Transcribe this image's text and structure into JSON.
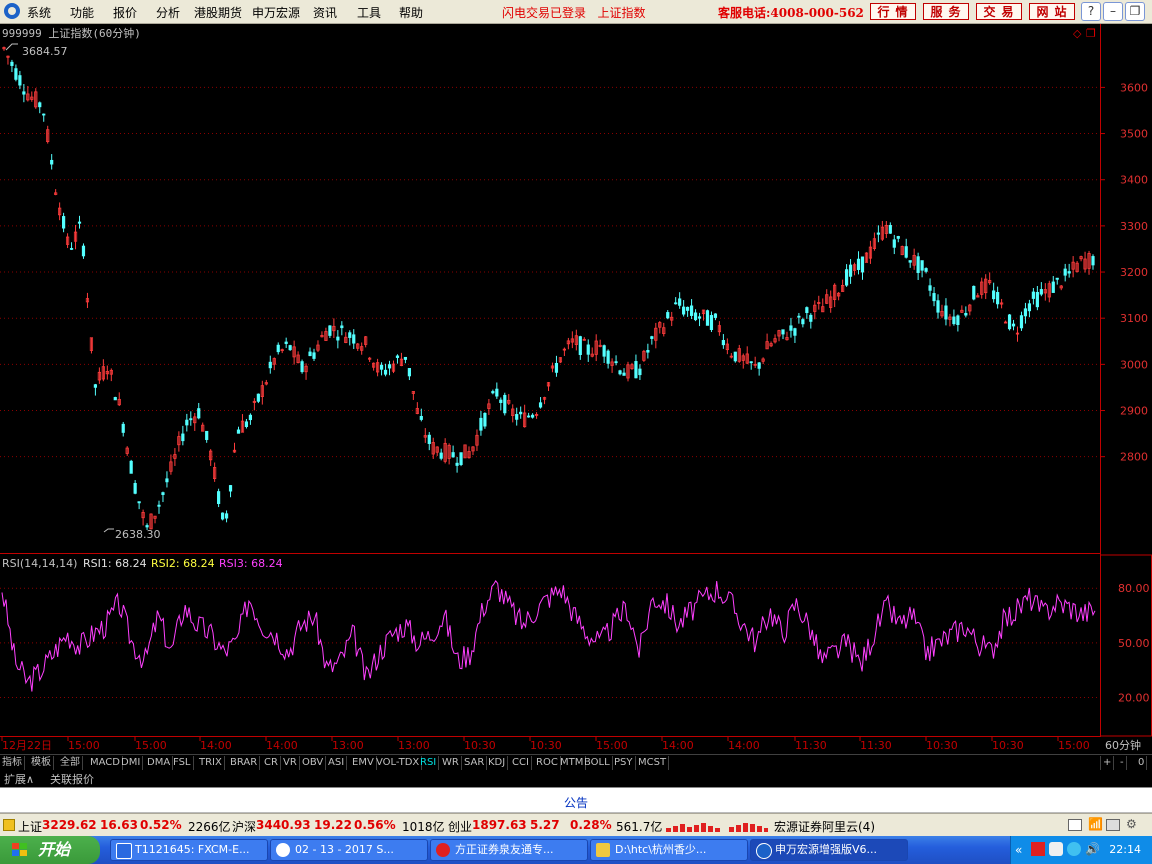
{
  "menu": {
    "items": [
      "系统",
      "功能",
      "报价",
      "分析",
      "港股期货",
      "申万宏源",
      "资讯",
      "工具",
      "帮助"
    ],
    "flash_status": "闪电交易已登录",
    "index_name": "上证指数",
    "hotline": "客服电话:4008-000-562",
    "nav_buttons": [
      "行情",
      "服务",
      "交易",
      "网站"
    ]
  },
  "price_panel": {
    "title": "999999 上证指数(60分钟)",
    "high_label": "3684.57",
    "low_label": "2638.30",
    "y_ticks": [
      "3600",
      "3500",
      "3400",
      "3300",
      "3200",
      "3100",
      "3000",
      "2900",
      "2800"
    ]
  },
  "rsi_panel": {
    "params": "RSI(14,14,14)",
    "rsi1_label": "RSI1: 68.24",
    "rsi2_label": "RSI2: 68.24",
    "rsi3_label": "RSI3: 68.24",
    "y_ticks": [
      "80.00",
      "50.00",
      "20.00"
    ]
  },
  "time_axis": {
    "labels": [
      "12月22日",
      "15:00",
      "15:00",
      "14:00",
      "14:00",
      "13:00",
      "13:00",
      "10:30",
      "10:30",
      "15:00",
      "14:00",
      "14:00",
      "11:30",
      "11:30",
      "10:30",
      "10:30",
      "15:00"
    ],
    "period": "60分钟",
    "controls": [
      "+",
      "-",
      "0"
    ]
  },
  "indicator_tabs": [
    "指标",
    "模板",
    "全部",
    "MACD",
    "DMI",
    "DMA",
    "FSL",
    "TRIX",
    "BRAR",
    "CR",
    "VR",
    "OBV",
    "ASI",
    "EMV",
    "VOL-TDX",
    "RSI",
    "WR",
    "SAR",
    "KDJ",
    "CCI",
    "ROC",
    "MTM",
    "BOLL",
    "PSY",
    "MCST"
  ],
  "sub_tabs": [
    "扩展∧",
    "关联报价"
  ],
  "announcement": "公告",
  "status": {
    "sh_label": "上证",
    "sh_value": "3229.62",
    "sh_change": "16.63",
    "sh_pct": "0.52%",
    "sh_vol": "2266亿",
    "hs_label": "沪深",
    "hs_value": "3440.93",
    "hs_change": "19.22",
    "hs_pct": "0.56%",
    "hs_vol": "1018亿",
    "cy_label": "创业",
    "cy_value": "1897.63",
    "cy_change": "5.27",
    "cy_pct": "0.28%",
    "cy_vol": "561.7亿",
    "server": "宏源证券阿里云(4)"
  },
  "taskbar": {
    "start": "开始",
    "tasks": [
      "T1121645: FXCM-E...",
      "02 - 13 - 2017 S...",
      "方正证券泉友通专...",
      "D:\\htc\\杭州香少...",
      "申万宏源增强版V6..."
    ],
    "clock": "22:14"
  },
  "colors": {
    "up": "#ff3c3c",
    "down": "#54ffff",
    "rsi": "#ff40ff",
    "axis": "#c00000",
    "grid": "#900000"
  },
  "chart_data": [
    {
      "type": "line",
      "title": "999999 上证指数(60分钟)",
      "series": [
        {
          "name": "",
          "values": [
            3684,
            3630,
            3580,
            3560,
            3380,
            3250,
            3300,
            2950,
            3000,
            2900,
            2750,
            2640,
            2700,
            2780,
            2870,
            2900,
            2800,
            2640,
            2860,
            2880,
            2950,
            3020,
            3040,
            2990,
            3030,
            3080,
            3070,
            3060,
            3040,
            2980,
            3000,
            3020,
            2880,
            2820,
            2810,
            2800,
            2810,
            2880,
            2940,
            2900,
            2880,
            2900,
            2960,
            3020,
            3050,
            3030,
            3040,
            3010,
            2980,
            2990,
            3050,
            3090,
            3130,
            3110,
            3100,
            3090,
            3030,
            3010,
            2990,
            3040,
            3060,
            3080,
            3110,
            3120,
            3150,
            3190,
            3210,
            3250,
            3300,
            3260,
            3230,
            3200,
            3130,
            3100,
            3110,
            3160,
            3170,
            3120,
            3070,
            3130,
            3150,
            3170,
            3190,
            3220,
            3230
          ]
        }
      ],
      "ylim": [
        2600,
        3720
      ]
    },
    {
      "type": "line",
      "title": "RSI(14,14,14)",
      "series": [
        {
          "name": "RSI1",
          "values": [
            80,
            40,
            28,
            35,
            45,
            55,
            48,
            55,
            60,
            72,
            50,
            40,
            65,
            45,
            70,
            60,
            55,
            45,
            50,
            75,
            60,
            55,
            45,
            60,
            65,
            35,
            40,
            55,
            30,
            45,
            55,
            60,
            50,
            55,
            65,
            40,
            45,
            70,
            82,
            70,
            60,
            68,
            75,
            80,
            65,
            55,
            50,
            60,
            70,
            45,
            75,
            72,
            60,
            68,
            75,
            80,
            72,
            60,
            50,
            68,
            55,
            72,
            60,
            40,
            45,
            50,
            38,
            55,
            70,
            60,
            65,
            45,
            50,
            55,
            60,
            50,
            45,
            62,
            68,
            75,
            66,
            72,
            70,
            66,
            68
          ]
        }
      ],
      "ylim": [
        0,
        90
      ]
    }
  ]
}
